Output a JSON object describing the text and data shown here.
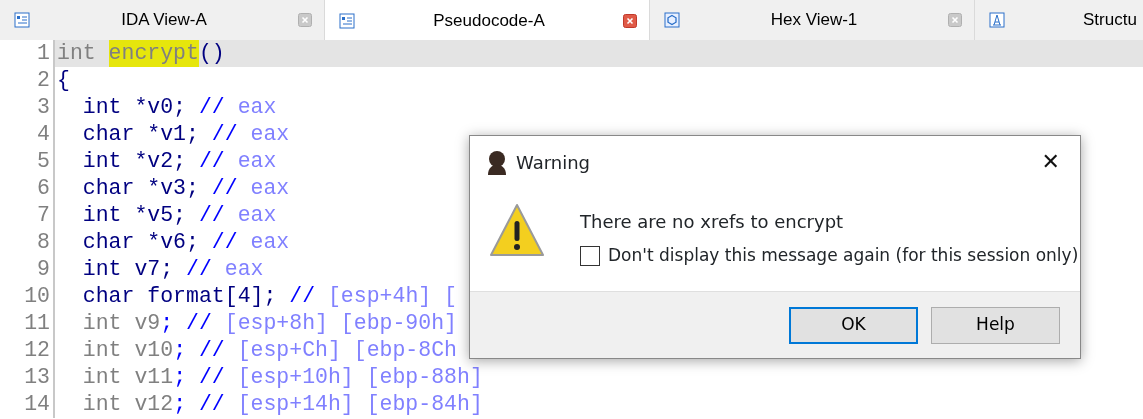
{
  "tabs": [
    {
      "label": "IDA View-A",
      "selected": false,
      "closable": true
    },
    {
      "label": "Pseudocode-A",
      "selected": true,
      "closable": true
    },
    {
      "label": "Hex View-1",
      "selected": false,
      "closable": true
    },
    {
      "label": "Structu",
      "selected": false,
      "closable": false
    }
  ],
  "code": {
    "lines": [
      {
        "number": "1",
        "current": true,
        "tokens": [
          {
            "text": "int ",
            "kind": "dim"
          },
          {
            "text": "encrypt",
            "kind": "highlight"
          },
          {
            "text": "()",
            "kind": "code"
          }
        ]
      },
      {
        "number": "2",
        "current": false,
        "tokens": [
          {
            "text": "{",
            "kind": "code"
          }
        ]
      },
      {
        "number": "3",
        "current": false,
        "tokens": [
          {
            "text": "  int *v0; ",
            "kind": "code"
          },
          {
            "text": "// ",
            "kind": "slash"
          },
          {
            "text": "eax",
            "kind": "comment"
          }
        ]
      },
      {
        "number": "4",
        "current": false,
        "tokens": [
          {
            "text": "  char *v1; ",
            "kind": "code"
          },
          {
            "text": "// ",
            "kind": "slash"
          },
          {
            "text": "eax",
            "kind": "comment"
          }
        ]
      },
      {
        "number": "5",
        "current": false,
        "tokens": [
          {
            "text": "  int *v2; ",
            "kind": "code"
          },
          {
            "text": "// ",
            "kind": "slash"
          },
          {
            "text": "eax",
            "kind": "comment"
          }
        ]
      },
      {
        "number": "6",
        "current": false,
        "tokens": [
          {
            "text": "  char *v3; ",
            "kind": "code"
          },
          {
            "text": "// ",
            "kind": "slash"
          },
          {
            "text": "eax",
            "kind": "comment"
          }
        ]
      },
      {
        "number": "7",
        "current": false,
        "tokens": [
          {
            "text": "  int *v5; ",
            "kind": "code"
          },
          {
            "text": "// ",
            "kind": "slash"
          },
          {
            "text": "eax",
            "kind": "comment"
          }
        ]
      },
      {
        "number": "8",
        "current": false,
        "tokens": [
          {
            "text": "  char *v6; ",
            "kind": "code"
          },
          {
            "text": "// ",
            "kind": "slash"
          },
          {
            "text": "eax",
            "kind": "comment"
          }
        ]
      },
      {
        "number": "9",
        "current": false,
        "tokens": [
          {
            "text": "  int v7; ",
            "kind": "code"
          },
          {
            "text": "// ",
            "kind": "slash"
          },
          {
            "text": "eax",
            "kind": "comment"
          }
        ]
      },
      {
        "number": "10",
        "current": false,
        "tokens": [
          {
            "text": "  char format[4]; ",
            "kind": "code"
          },
          {
            "text": "// ",
            "kind": "slash"
          },
          {
            "text": "[esp+4h] [",
            "kind": "comment"
          }
        ]
      },
      {
        "number": "11",
        "current": false,
        "tokens": [
          {
            "text": "  int v9",
            "kind": "dim"
          },
          {
            "text": "; // ",
            "kind": "slash"
          },
          {
            "text": "[esp+8h] [ebp-90h]",
            "kind": "comment"
          }
        ]
      },
      {
        "number": "12",
        "current": false,
        "tokens": [
          {
            "text": "  int v10",
            "kind": "dim"
          },
          {
            "text": "; // ",
            "kind": "slash"
          },
          {
            "text": "[esp+Ch] [ebp-8Ch",
            "kind": "comment"
          }
        ]
      },
      {
        "number": "13",
        "current": false,
        "tokens": [
          {
            "text": "  int v11",
            "kind": "dim"
          },
          {
            "text": "; // ",
            "kind": "slash"
          },
          {
            "text": "[esp+10h] [ebp-88h]",
            "kind": "comment"
          }
        ]
      },
      {
        "number": "14",
        "current": false,
        "tokens": [
          {
            "text": "  int v12",
            "kind": "dim"
          },
          {
            "text": "; // ",
            "kind": "slash"
          },
          {
            "text": "[esp+14h] [ebp-84h]",
            "kind": "comment"
          }
        ]
      }
    ]
  },
  "dialog": {
    "title": "Warning",
    "close": "✕",
    "message": "There are no xrefs to encrypt",
    "checkbox": {
      "label": "Don't display this message again (for this session only)",
      "checked": false
    },
    "buttons": [
      {
        "label": "OK",
        "focused": true
      },
      {
        "label": "Help",
        "focused": false
      }
    ]
  }
}
